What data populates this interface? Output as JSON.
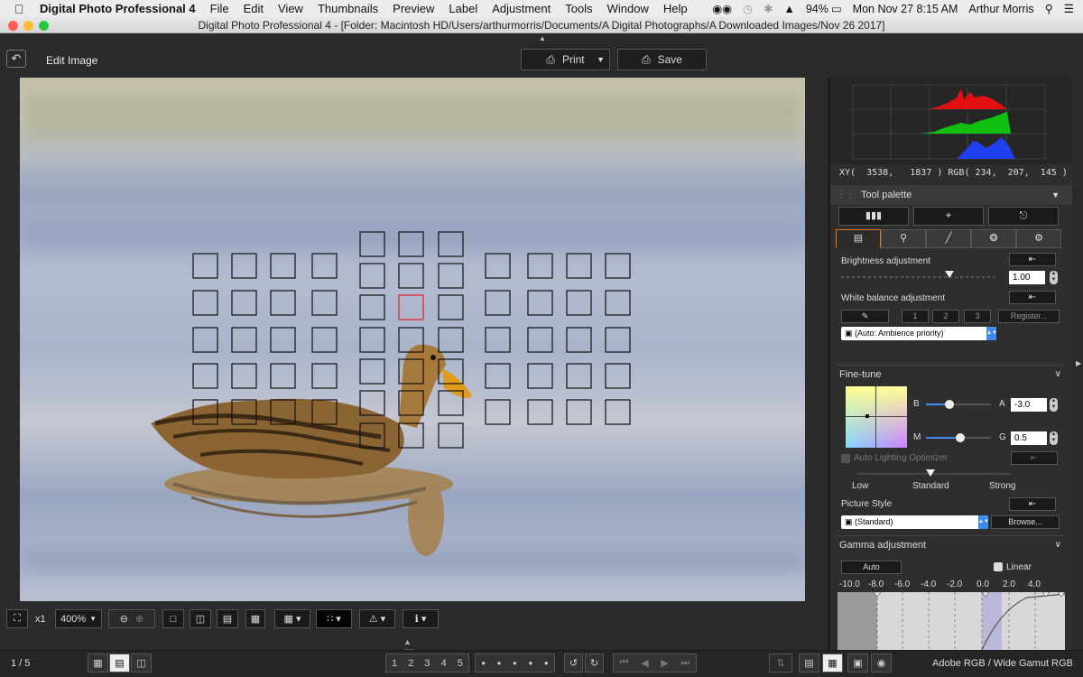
{
  "menubar": {
    "app_name": "Digital Photo Professional 4",
    "items": [
      "File",
      "Edit",
      "View",
      "Thumbnails",
      "Preview",
      "Label",
      "Adjustment",
      "Tools",
      "Window",
      "Help"
    ],
    "battery": "94%",
    "datetime": "Mon Nov 27  8:15 AM",
    "user": "Arthur Morris"
  },
  "window": {
    "title": "Digital Photo Professional 4 - [Folder: Macintosh HD/Users/arthurmorris/Documents/A Digital Photographs/A Downloaded Images/Nov 26 2017]"
  },
  "toolbar": {
    "edit_title": "Edit Image",
    "print_label": "Print",
    "save_label": "Save"
  },
  "histogram": {
    "coords": "XY(  3538,   1837 ) RGB( 234,  207,  145 )",
    "colors": {
      "red": "#e01010",
      "green": "#10c010",
      "blue": "#2040f0"
    }
  },
  "palette": {
    "title": "Tool palette",
    "brightness_label": "Brightness adjustment",
    "brightness_value": "1.00",
    "wb_label": "White balance adjustment",
    "wb_buttons": [
      "1",
      "2",
      "3"
    ],
    "wb_register": "Register...",
    "wb_select": "(Auto: Ambience priority)",
    "finetune_label": "Fine-tune",
    "b_label": "B",
    "a_label": "A",
    "a_value": "-3.0",
    "m_label": "M",
    "g_label": "G",
    "g_value": "0.5",
    "alo_label": "Auto Lighting Optimizer",
    "alo_low": "Low",
    "alo_standard": "Standard",
    "alo_strong": "Strong",
    "ps_label": "Picture Style",
    "ps_select": "(Standard)",
    "ps_browse": "Browse...",
    "gamma_label": "Gamma adjustment",
    "gamma_auto": "Auto",
    "gamma_linear": "Linear",
    "gamma_ticks": [
      "-10.0",
      "-8.0",
      "-6.0",
      "-4.0",
      "-2.0",
      "0.0",
      "2.0",
      "4.0"
    ]
  },
  "viewbar": {
    "zoom_x1": "x1",
    "zoom_value": "400%"
  },
  "statusbar": {
    "count": "1 / 5",
    "ratings": [
      "1",
      "2",
      "3",
      "4",
      "5"
    ],
    "color_space": "Adobe RGB / Wide Gamut RGB"
  },
  "accent": "#e07a1c"
}
